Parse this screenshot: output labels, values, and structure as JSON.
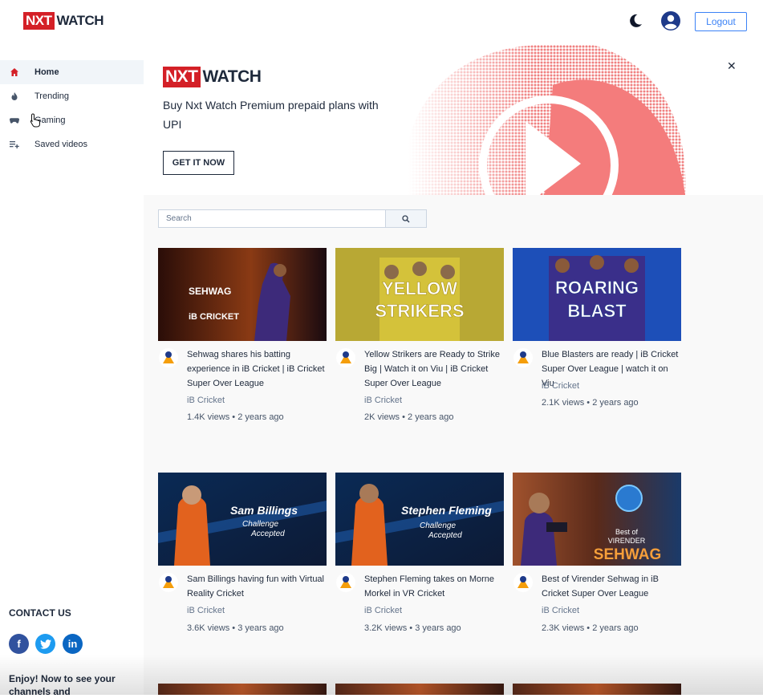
{
  "header": {
    "logo_box": "NXT",
    "logo_text": "WATCH",
    "logout_label": "Logout"
  },
  "sidebar": {
    "items": [
      {
        "label": "Home",
        "icon": "home-icon",
        "active": true
      },
      {
        "label": "Trending",
        "icon": "fire-icon"
      },
      {
        "label": "Gaming",
        "icon": "gamepad-icon"
      },
      {
        "label": "Saved videos",
        "icon": "playlist-add-icon"
      }
    ],
    "contact_title": "CONTACT US",
    "social": [
      "facebook-icon",
      "twitter-icon",
      "linkedin-icon"
    ],
    "enjoy_text": "Enjoy! Now to see your channels and"
  },
  "banner": {
    "logo_box": "NXT",
    "logo_text": "WATCH",
    "text": "Buy Nxt Watch Premium prepaid plans with UPI",
    "button_label": "GET IT NOW"
  },
  "search": {
    "placeholder": "Search"
  },
  "videos": [
    {
      "title": "Sehwag shares his batting experience in iB Cricket | iB Cricket Super Over League",
      "channel": "iB Cricket",
      "views": "1.4K views",
      "published": "2 years ago",
      "thumb_text": [
        "SEHWAG",
        "iB CRICKET"
      ]
    },
    {
      "title": "Yellow Strikers are Ready to Strike Big | Watch it on Viu | iB Cricket Super Over League",
      "channel": "iB Cricket",
      "views": "2K views",
      "published": "2 years ago",
      "thumb_text": [
        "YELLOW",
        "STRIKERS"
      ]
    },
    {
      "title": "Blue Blasters are ready | iB Cricket Super Over League | watch it on Viu",
      "channel": "iB Cricket",
      "views": "2.1K views",
      "published": "2 years ago",
      "thumb_text": [
        "ROARING",
        "BLAST"
      ]
    },
    {
      "title": "Sam Billings having fun with Virtual Reality Cricket",
      "channel": "iB Cricket",
      "views": "3.6K views",
      "published": "3 years ago",
      "thumb_text": [
        "Sam Billings",
        "Challenge",
        "Accepted"
      ]
    },
    {
      "title": "Stephen Fleming takes on Morne Morkel in VR Cricket",
      "channel": "iB Cricket",
      "views": "3.2K views",
      "published": "3 years ago",
      "thumb_text": [
        "Stephen Fleming",
        "Challenge",
        "Accepted"
      ]
    },
    {
      "title": "Best of Virender Sehwag in iB Cricket Super Over League",
      "channel": "iB Cricket",
      "views": "2.3K views",
      "published": "2 years ago",
      "thumb_text": [
        "Best of",
        "VIRENDER",
        "SEHWAG"
      ]
    }
  ],
  "meta_separator": "•",
  "colors": {
    "brand_red": "#d42027",
    "accent_blue": "#3b82f6",
    "active_bg": "#f1f5f9",
    "main_bg": "#f9f9f9"
  }
}
